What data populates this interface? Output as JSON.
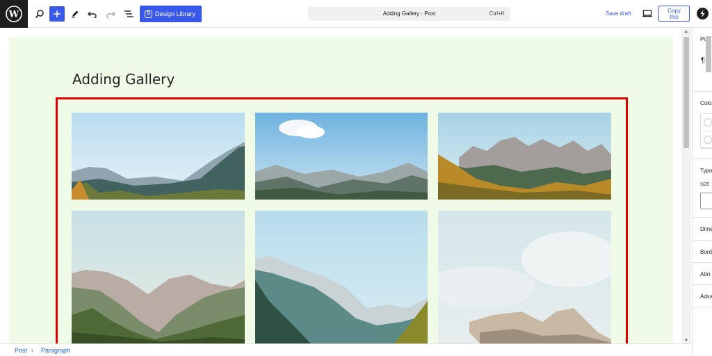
{
  "toolbar": {
    "design_library_label": "Design Library",
    "document_title": "Adding Gallery · Post",
    "shortcut": "Ctrl+K",
    "save_draft_label": "Save draft",
    "copy_label_line1": "Copy",
    "copy_label_line2": "this",
    "accent_color": "#3858e9"
  },
  "post": {
    "title": "Adding Gallery"
  },
  "gallery": {
    "images": [
      {
        "id": "img-1",
        "alt": ""
      },
      {
        "id": "img-2",
        "alt": ""
      },
      {
        "id": "img-3",
        "alt": ""
      },
      {
        "id": "img-4",
        "alt": ""
      },
      {
        "id": "img-5",
        "alt": ""
      },
      {
        "id": "img-6",
        "alt": ""
      }
    ],
    "highlight_color": "#e10000"
  },
  "sidebar": {
    "tab_post": "Post",
    "paragraph_symbol": "¶",
    "color_label": "Colo",
    "typography_label": "Typo",
    "size_label": "SIZE",
    "dimensions_label": "Dime",
    "border_label": "Bord",
    "attributes_label": "Attri",
    "advanced_label": "Adva"
  },
  "breadcrumb": {
    "items": [
      "Post",
      "Paragraph"
    ],
    "separator": "›"
  }
}
